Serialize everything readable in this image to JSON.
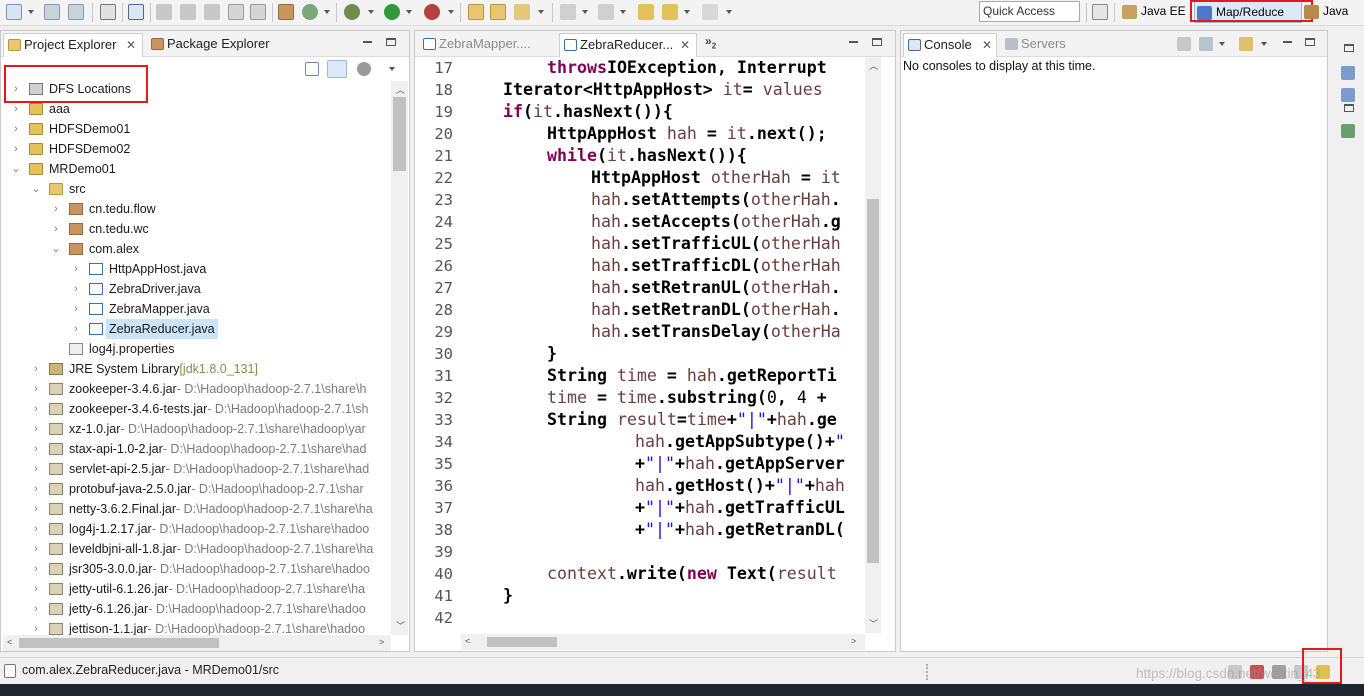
{
  "toolbar": {
    "quick_access_placeholder": "Quick Access",
    "perspectives": [
      {
        "label": "Java EE",
        "active": false
      },
      {
        "label": "Map/Reduce",
        "active": true
      },
      {
        "label": "Java",
        "active": false
      }
    ]
  },
  "left_panel": {
    "tabs": [
      {
        "label": "Project Explorer",
        "active": true
      },
      {
        "label": "Package Explorer",
        "active": false
      }
    ],
    "tree": [
      {
        "label": "DFS Locations",
        "decoration": "",
        "depth": 0,
        "expanded": false,
        "has_arrow": true,
        "kind": "dfs",
        "selected": false
      },
      {
        "label": "aaa",
        "decoration": "",
        "depth": 0,
        "expanded": false,
        "has_arrow": true,
        "kind": "proj",
        "selected": false
      },
      {
        "label": "HDFSDemo01",
        "decoration": "",
        "depth": 0,
        "expanded": false,
        "has_arrow": true,
        "kind": "proj",
        "selected": false
      },
      {
        "label": "HDFSDemo02",
        "decoration": "",
        "depth": 0,
        "expanded": false,
        "has_arrow": true,
        "kind": "proj",
        "selected": false
      },
      {
        "label": "MRDemo01",
        "decoration": "",
        "depth": 0,
        "expanded": true,
        "has_arrow": true,
        "kind": "proj",
        "selected": false
      },
      {
        "label": "src",
        "decoration": "",
        "depth": 1,
        "expanded": true,
        "has_arrow": true,
        "kind": "folder",
        "selected": false
      },
      {
        "label": "cn.tedu.flow",
        "decoration": "",
        "depth": 2,
        "expanded": false,
        "has_arrow": true,
        "kind": "pkg",
        "selected": false
      },
      {
        "label": "cn.tedu.wc",
        "decoration": "",
        "depth": 2,
        "expanded": false,
        "has_arrow": true,
        "kind": "pkg",
        "selected": false
      },
      {
        "label": "com.alex",
        "decoration": "",
        "depth": 2,
        "expanded": true,
        "has_arrow": true,
        "kind": "pkg",
        "selected": false
      },
      {
        "label": "HttpAppHost.java",
        "decoration": "",
        "depth": 3,
        "expanded": false,
        "has_arrow": true,
        "kind": "java",
        "selected": false
      },
      {
        "label": "ZebraDriver.java",
        "decoration": "",
        "depth": 3,
        "expanded": false,
        "has_arrow": true,
        "kind": "java",
        "selected": false
      },
      {
        "label": "ZebraMapper.java",
        "decoration": "",
        "depth": 3,
        "expanded": false,
        "has_arrow": true,
        "kind": "java",
        "selected": false
      },
      {
        "label": "ZebraReducer.java",
        "decoration": "",
        "depth": 3,
        "expanded": false,
        "has_arrow": true,
        "kind": "java",
        "selected": true
      },
      {
        "label": "log4j.properties",
        "decoration": "",
        "depth": 2,
        "expanded": false,
        "has_arrow": false,
        "kind": "props",
        "selected": false
      },
      {
        "label": "JRE System Library",
        "decoration": "[jdk1.8.0_131]",
        "depth": 1,
        "expanded": false,
        "has_arrow": true,
        "kind": "lib",
        "selected": false
      },
      {
        "label": "zookeeper-3.4.6.jar",
        "decoration": "- D:\\Hadoop\\hadoop-2.7.1\\share\\h",
        "depth": 1,
        "expanded": false,
        "has_arrow": true,
        "kind": "jar",
        "selected": false
      },
      {
        "label": "zookeeper-3.4.6-tests.jar",
        "decoration": "- D:\\Hadoop\\hadoop-2.7.1\\sh",
        "depth": 1,
        "expanded": false,
        "has_arrow": true,
        "kind": "jar",
        "selected": false
      },
      {
        "label": "xz-1.0.jar",
        "decoration": "- D:\\Hadoop\\hadoop-2.7.1\\share\\hadoop\\yar",
        "depth": 1,
        "expanded": false,
        "has_arrow": true,
        "kind": "jar",
        "selected": false
      },
      {
        "label": "stax-api-1.0-2.jar",
        "decoration": "- D:\\Hadoop\\hadoop-2.7.1\\share\\had",
        "depth": 1,
        "expanded": false,
        "has_arrow": true,
        "kind": "jar",
        "selected": false
      },
      {
        "label": "servlet-api-2.5.jar",
        "decoration": "- D:\\Hadoop\\hadoop-2.7.1\\share\\had",
        "depth": 1,
        "expanded": false,
        "has_arrow": true,
        "kind": "jar",
        "selected": false
      },
      {
        "label": "protobuf-java-2.5.0.jar",
        "decoration": "- D:\\Hadoop\\hadoop-2.7.1\\shar",
        "depth": 1,
        "expanded": false,
        "has_arrow": true,
        "kind": "jar",
        "selected": false
      },
      {
        "label": "netty-3.6.2.Final.jar",
        "decoration": "- D:\\Hadoop\\hadoop-2.7.1\\share\\ha",
        "depth": 1,
        "expanded": false,
        "has_arrow": true,
        "kind": "jar",
        "selected": false
      },
      {
        "label": "log4j-1.2.17.jar",
        "decoration": "- D:\\Hadoop\\hadoop-2.7.1\\share\\hadoo",
        "depth": 1,
        "expanded": false,
        "has_arrow": true,
        "kind": "jar",
        "selected": false
      },
      {
        "label": "leveldbjni-all-1.8.jar",
        "decoration": "- D:\\Hadoop\\hadoop-2.7.1\\share\\ha",
        "depth": 1,
        "expanded": false,
        "has_arrow": true,
        "kind": "jar",
        "selected": false
      },
      {
        "label": "jsr305-3.0.0.jar",
        "decoration": "- D:\\Hadoop\\hadoop-2.7.1\\share\\hadoo",
        "depth": 1,
        "expanded": false,
        "has_arrow": true,
        "kind": "jar",
        "selected": false
      },
      {
        "label": "jetty-util-6.1.26.jar",
        "decoration": "- D:\\Hadoop\\hadoop-2.7.1\\share\\ha",
        "depth": 1,
        "expanded": false,
        "has_arrow": true,
        "kind": "jar",
        "selected": false
      },
      {
        "label": "jetty-6.1.26.jar",
        "decoration": "- D:\\Hadoop\\hadoop-2.7.1\\share\\hadoo",
        "depth": 1,
        "expanded": false,
        "has_arrow": true,
        "kind": "jar",
        "selected": false
      },
      {
        "label": "jettison-1.1.jar",
        "decoration": "- D:\\Hadoop\\hadoop-2.7.1\\share\\hadoo",
        "depth": 1,
        "expanded": false,
        "has_arrow": true,
        "kind": "jar",
        "selected": false
      }
    ]
  },
  "editor": {
    "tabs": [
      {
        "label": "ZebraMapper....",
        "active": false
      },
      {
        "label": "ZebraReducer...",
        "active": true
      }
    ],
    "overflow_count": "2",
    "lines": [
      {
        "num": "17",
        "indent": 2,
        "tokens": [
          [
            "kw",
            "throws"
          ],
          [
            "",
            "IOException, Interrupt"
          ]
        ]
      },
      {
        "num": "18",
        "indent": 1,
        "tokens": [
          [
            "",
            "Iterator<HttpAppHost> "
          ],
          [
            "fld",
            "it"
          ],
          [
            "",
            ""
          ],
          [
            "",
            "",
            " "
          ],
          [
            "",
            "= "
          ],
          [
            "fld",
            "values"
          ]
        ]
      },
      {
        "num": "19",
        "indent": 1,
        "tokens": [
          [
            "kw",
            "if"
          ],
          [
            "",
            "("
          ],
          [
            "fld",
            "it"
          ],
          [
            "",
            ".hasNext()){"
          ]
        ]
      },
      {
        "num": "20",
        "indent": 2,
        "tokens": [
          [
            "",
            "HttpAppHost "
          ],
          [
            "fld",
            "hah"
          ],
          [
            "",
            " = "
          ],
          [
            "fld",
            "it"
          ],
          [
            "",
            ".next();"
          ]
        ]
      },
      {
        "num": "21",
        "indent": 2,
        "tokens": [
          [
            "kw",
            "while"
          ],
          [
            "",
            "("
          ],
          [
            "fld",
            "it"
          ],
          [
            "",
            ".hasNext()){"
          ]
        ]
      },
      {
        "num": "22",
        "indent": 3,
        "tokens": [
          [
            "",
            "HttpAppHost "
          ],
          [
            "fld",
            "otherHah"
          ],
          [
            "",
            " = "
          ],
          [
            "fld",
            "it"
          ]
        ]
      },
      {
        "num": "23",
        "indent": 3,
        "tokens": [
          [
            "fld",
            "hah"
          ],
          [
            "",
            ".setAttempts("
          ],
          [
            "fld",
            "otherHah"
          ],
          [
            "",
            "."
          ]
        ]
      },
      {
        "num": "24",
        "indent": 3,
        "tokens": [
          [
            "fld",
            "hah"
          ],
          [
            "",
            ".setAccepts("
          ],
          [
            "fld",
            "otherHah"
          ],
          [
            "",
            ".g"
          ]
        ]
      },
      {
        "num": "25",
        "indent": 3,
        "tokens": [
          [
            "fld",
            "hah"
          ],
          [
            "",
            ".setTrafficUL("
          ],
          [
            "fld",
            "otherHah"
          ]
        ]
      },
      {
        "num": "26",
        "indent": 3,
        "tokens": [
          [
            "fld",
            "hah"
          ],
          [
            "",
            ".setTrafficDL("
          ],
          [
            "fld",
            "otherHah"
          ]
        ]
      },
      {
        "num": "27",
        "indent": 3,
        "tokens": [
          [
            "fld",
            "hah"
          ],
          [
            "",
            ".setRetranUL("
          ],
          [
            "fld",
            "otherHah"
          ],
          [
            "",
            "."
          ]
        ]
      },
      {
        "num": "28",
        "indent": 3,
        "tokens": [
          [
            "fld",
            "hah"
          ],
          [
            "",
            ".setRetranDL("
          ],
          [
            "fld",
            "otherHah"
          ],
          [
            "",
            "."
          ]
        ]
      },
      {
        "num": "29",
        "indent": 3,
        "tokens": [
          [
            "fld",
            "hah"
          ],
          [
            "",
            ".setTransDelay("
          ],
          [
            "fld",
            "otherHa"
          ]
        ]
      },
      {
        "num": "30",
        "indent": 2,
        "tokens": [
          [
            "",
            "}"
          ]
        ]
      },
      {
        "num": "31",
        "indent": 2,
        "tokens": [
          [
            "",
            "String "
          ],
          [
            "fld",
            "time"
          ],
          [
            "",
            " = "
          ],
          [
            "fld",
            "hah"
          ],
          [
            "",
            ".getReportTi"
          ]
        ]
      },
      {
        "num": "32",
        "indent": 2,
        "tokens": [
          [
            "fld",
            "time"
          ],
          [
            "",
            " = "
          ],
          [
            "fld",
            "time"
          ],
          [
            "",
            ".substring("
          ],
          [
            "num",
            "0"
          ],
          [
            "",
            ", "
          ],
          [
            "num",
            "4"
          ],
          [
            "",
            " +"
          ]
        ]
      },
      {
        "num": "33",
        "indent": 2,
        "tokens": [
          [
            "",
            "String "
          ],
          [
            "fld",
            "result"
          ],
          [
            "",
            "="
          ],
          [
            "fld",
            "time"
          ],
          [
            "",
            "+"
          ],
          [
            "str",
            "\"|\""
          ],
          [
            "",
            "+"
          ],
          [
            "fld",
            "hah"
          ],
          [
            "",
            ".ge"
          ]
        ]
      },
      {
        "num": "34",
        "indent": 4,
        "tokens": [
          [
            "fld",
            "hah"
          ],
          [
            "",
            ".getAppSubtype()+"
          ],
          [
            "str",
            "\""
          ]
        ]
      },
      {
        "num": "35",
        "indent": 4,
        "tokens": [
          [
            "",
            "+"
          ],
          [
            "str",
            "\"|\""
          ],
          [
            "",
            "+"
          ],
          [
            "fld",
            "hah"
          ],
          [
            "",
            ".getAppServer"
          ]
        ]
      },
      {
        "num": "36",
        "indent": 4,
        "tokens": [
          [
            "fld",
            "hah"
          ],
          [
            "",
            ".getHost()+"
          ],
          [
            "str",
            "\"|\""
          ],
          [
            "",
            "+"
          ],
          [
            "fld",
            "hah"
          ]
        ]
      },
      {
        "num": "37",
        "indent": 4,
        "tokens": [
          [
            "",
            "+"
          ],
          [
            "str",
            "\"|\""
          ],
          [
            "",
            "+"
          ],
          [
            "fld",
            "hah"
          ],
          [
            "",
            ".getTrafficUL"
          ]
        ]
      },
      {
        "num": "38",
        "indent": 4,
        "tokens": [
          [
            "",
            "+"
          ],
          [
            "str",
            "\"|\""
          ],
          [
            "",
            "+"
          ],
          [
            "fld",
            "hah"
          ],
          [
            "",
            ".getRetranDL("
          ]
        ]
      },
      {
        "num": "39",
        "indent": 0,
        "tokens": []
      },
      {
        "num": "40",
        "indent": 2,
        "tokens": [
          [
            "fld",
            "context"
          ],
          [
            "",
            ".write("
          ],
          [
            "kw",
            "new"
          ],
          [
            "",
            " Text("
          ],
          [
            "fld",
            "result"
          ]
        ]
      },
      {
        "num": "41",
        "indent": 1,
        "tokens": [
          [
            "",
            "}"
          ]
        ]
      },
      {
        "num": "42",
        "indent": 0,
        "tokens": []
      }
    ]
  },
  "console": {
    "tabs": [
      {
        "label": "Console",
        "active": true
      },
      {
        "label": "Servers",
        "active": false
      }
    ],
    "message": "No consoles to display at this time."
  },
  "status_bar": {
    "text": "com.alex.ZebraReducer.java - MRDemo01/src",
    "watermark": "https://blog.csdn.net/weixin_43"
  },
  "colors": {
    "keyword": "#7f0055",
    "field": "#6a3e3e",
    "string": "#2a00ff",
    "highlight": "#e21a1a"
  }
}
